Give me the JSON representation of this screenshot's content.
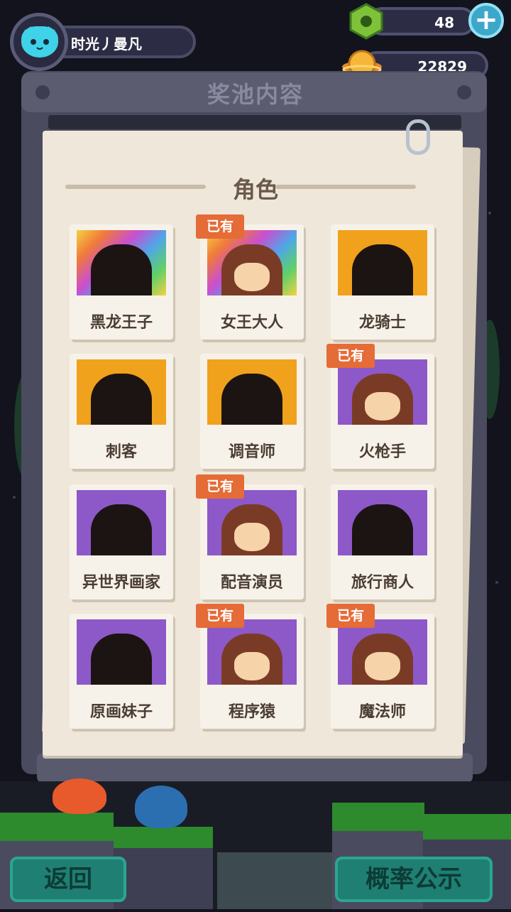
{
  "header": {
    "player_name": "时光丿曼凡",
    "currency_gem": "48",
    "currency_coin": "22829",
    "add_icon": "plus-icon"
  },
  "panel": {
    "title": "奖池内容",
    "section": "角色"
  },
  "owned_label": "已有",
  "cards": [
    {
      "name": "黑龙王子",
      "owned": false,
      "bg": "rainbow"
    },
    {
      "name": "女王大人",
      "owned": true,
      "bg": "rainbow"
    },
    {
      "name": "龙骑士",
      "owned": false,
      "bg": "#f0a21c"
    },
    {
      "name": "刺客",
      "owned": false,
      "bg": "#f0a21c"
    },
    {
      "name": "调音师",
      "owned": false,
      "bg": "#f0a21c"
    },
    {
      "name": "火枪手",
      "owned": true,
      "bg": "#8d58c8"
    },
    {
      "name": "异世界画家",
      "owned": false,
      "bg": "#8d58c8"
    },
    {
      "name": "配音演员",
      "owned": true,
      "bg": "#8d58c8"
    },
    {
      "name": "旅行商人",
      "owned": false,
      "bg": "#8d58c8"
    },
    {
      "name": "原画妹子",
      "owned": false,
      "bg": "#8d58c8"
    },
    {
      "name": "程序猿",
      "owned": true,
      "bg": "#8d58c8"
    },
    {
      "name": "魔法师",
      "owned": true,
      "bg": "#8d58c8"
    }
  ],
  "footer": {
    "back": "返回",
    "probability": "概率公示"
  },
  "colors": {
    "owned_badge": "#e56b37",
    "gold_bg": "#f0a21c",
    "purple_bg": "#8d58c8",
    "button": "#1f7f73"
  }
}
